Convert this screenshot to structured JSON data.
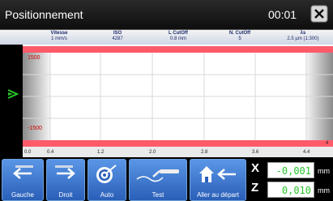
{
  "titlebar": {
    "title": "Positionnement",
    "time": "00:01"
  },
  "header": [
    {
      "label": "Vitesse",
      "value": "1 mm/s"
    },
    {
      "label": "ISO",
      "value": "4287"
    },
    {
      "label": "L CutOff",
      "value": "0.8 mm"
    },
    {
      "label": "N. CutOff",
      "value": "5"
    },
    {
      "label": "λs",
      "value": "2.5 µm (1:300)"
    }
  ],
  "plot": {
    "y_top": "1500",
    "y_bottom": "-1500",
    "x_ticks": [
      "0.0",
      "0.4",
      "1.2",
      "2.0",
      "2.8",
      "3.6",
      "4.4",
      "4"
    ]
  },
  "toolbar": {
    "left": "Gauche",
    "right": "Droit",
    "auto": "Auto",
    "test": "Test",
    "start": "Aller au départ"
  },
  "coords": {
    "x_axis": "X",
    "x_value": "-0,001",
    "x_unit": "mm",
    "z_axis": "Z",
    "z_value": "0,010",
    "z_unit": "mm"
  },
  "colors": {
    "accent": "#3f7fdc",
    "limit_band": "#ff5a6a",
    "value_green": "#2ac42a"
  }
}
